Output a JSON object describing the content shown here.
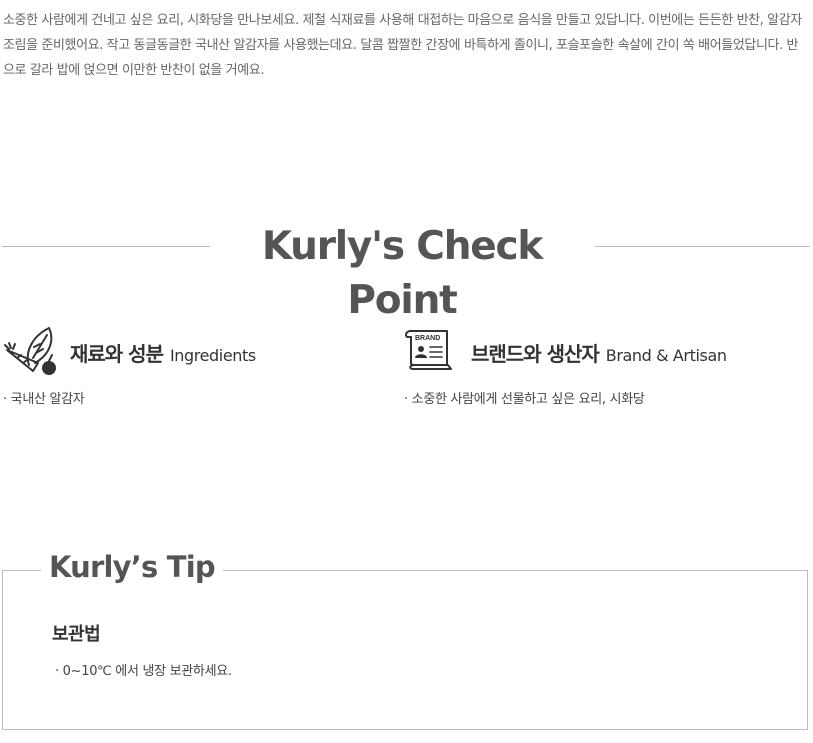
{
  "intro": {
    "text": "소중한 사람에게 건네고 싶은 요리, 시화당을 만나보세요. 제철 식재료를 사용해 대접하는 마음으로 음식을 만들고 있답니다. 이번에는 든든한 반찬, 알감자조림을 준비했어요. 작고 동글동글한 국내산 알감자를 사용했는데요. 달콤 짭짤한 간장에 바특하게 졸이니, 포슬포슬한 속살에 간이 쏙 배어들었답니다. 반으로 갈라 밥에 얹으면 이만한 반찬이 없을 거예요."
  },
  "check_point": {
    "title": "Kurly's Check Point",
    "ingredients": {
      "title_ko": "재료와 성분",
      "title_en": "Ingredients",
      "icon": "vegetables-icon",
      "item": "· 국내산 알감자"
    },
    "brand": {
      "title_ko": "브랜드와 생산자",
      "title_en": "Brand & Artisan",
      "icon": "brand-certificate-icon",
      "icon_label": "BRAND",
      "item": "· 소중한 사람에게 선물하고 싶은 요리, 시화당"
    }
  },
  "tip": {
    "title": "Kurly’s Tip",
    "subtitle": "보관법",
    "items": [
      "· 0~10℃ 에서 냉장 보관하세요."
    ]
  }
}
